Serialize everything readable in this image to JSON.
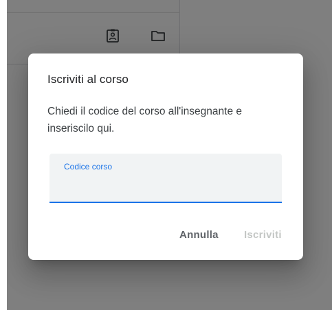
{
  "background": {
    "icons": [
      "assignment-ind-icon",
      "folder-icon"
    ]
  },
  "dialog": {
    "title": "Iscriviti al corso",
    "body": "Chiedi il codice del corso all'insegnante e inseriscilo qui.",
    "field": {
      "label": "Codice corso",
      "value": ""
    },
    "cancel_label": "Annulla",
    "join_label": "Iscriviti"
  },
  "colors": {
    "accent": "#1a73e8",
    "disabled": "#c4c7c5",
    "text_primary": "#202124",
    "text_secondary": "#5f6368"
  }
}
